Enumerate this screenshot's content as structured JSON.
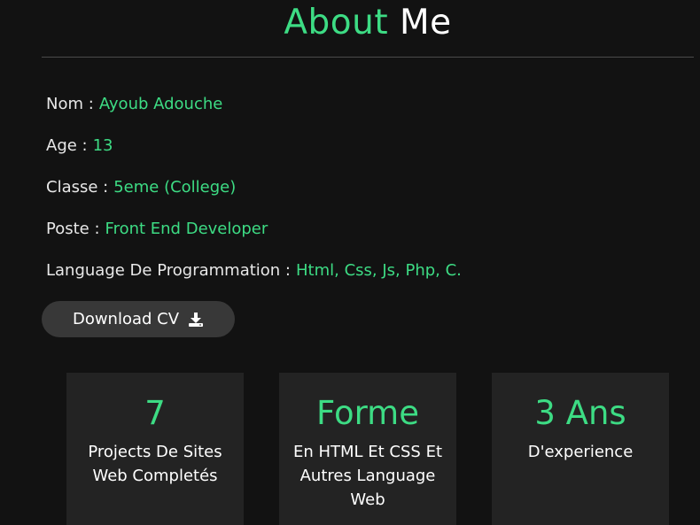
{
  "header": {
    "title_accent": "About",
    "title_rest": "Me"
  },
  "info": [
    {
      "label": "Nom :",
      "value": "Ayoub Adouche"
    },
    {
      "label": "Age :",
      "value": "13"
    },
    {
      "label": "Classe :",
      "value": "5eme (College)"
    },
    {
      "label": "Poste :",
      "value": "Front End Developer"
    },
    {
      "label": "Language De Programmation :",
      "value": "Html, Css, Js, Php, C."
    }
  ],
  "download": {
    "label": "Download CV",
    "icon": "download-icon"
  },
  "cards": [
    {
      "big": "7",
      "desc": "Projects De Sites Web Completés"
    },
    {
      "big": "Forme",
      "desc": "En HTML Et CSS Et Autres Language Web"
    },
    {
      "big": "3 Ans",
      "desc": "D'experience"
    }
  ],
  "colors": {
    "accent": "#3ddc84",
    "background": "#121212",
    "card": "#232323",
    "button": "#383838"
  }
}
